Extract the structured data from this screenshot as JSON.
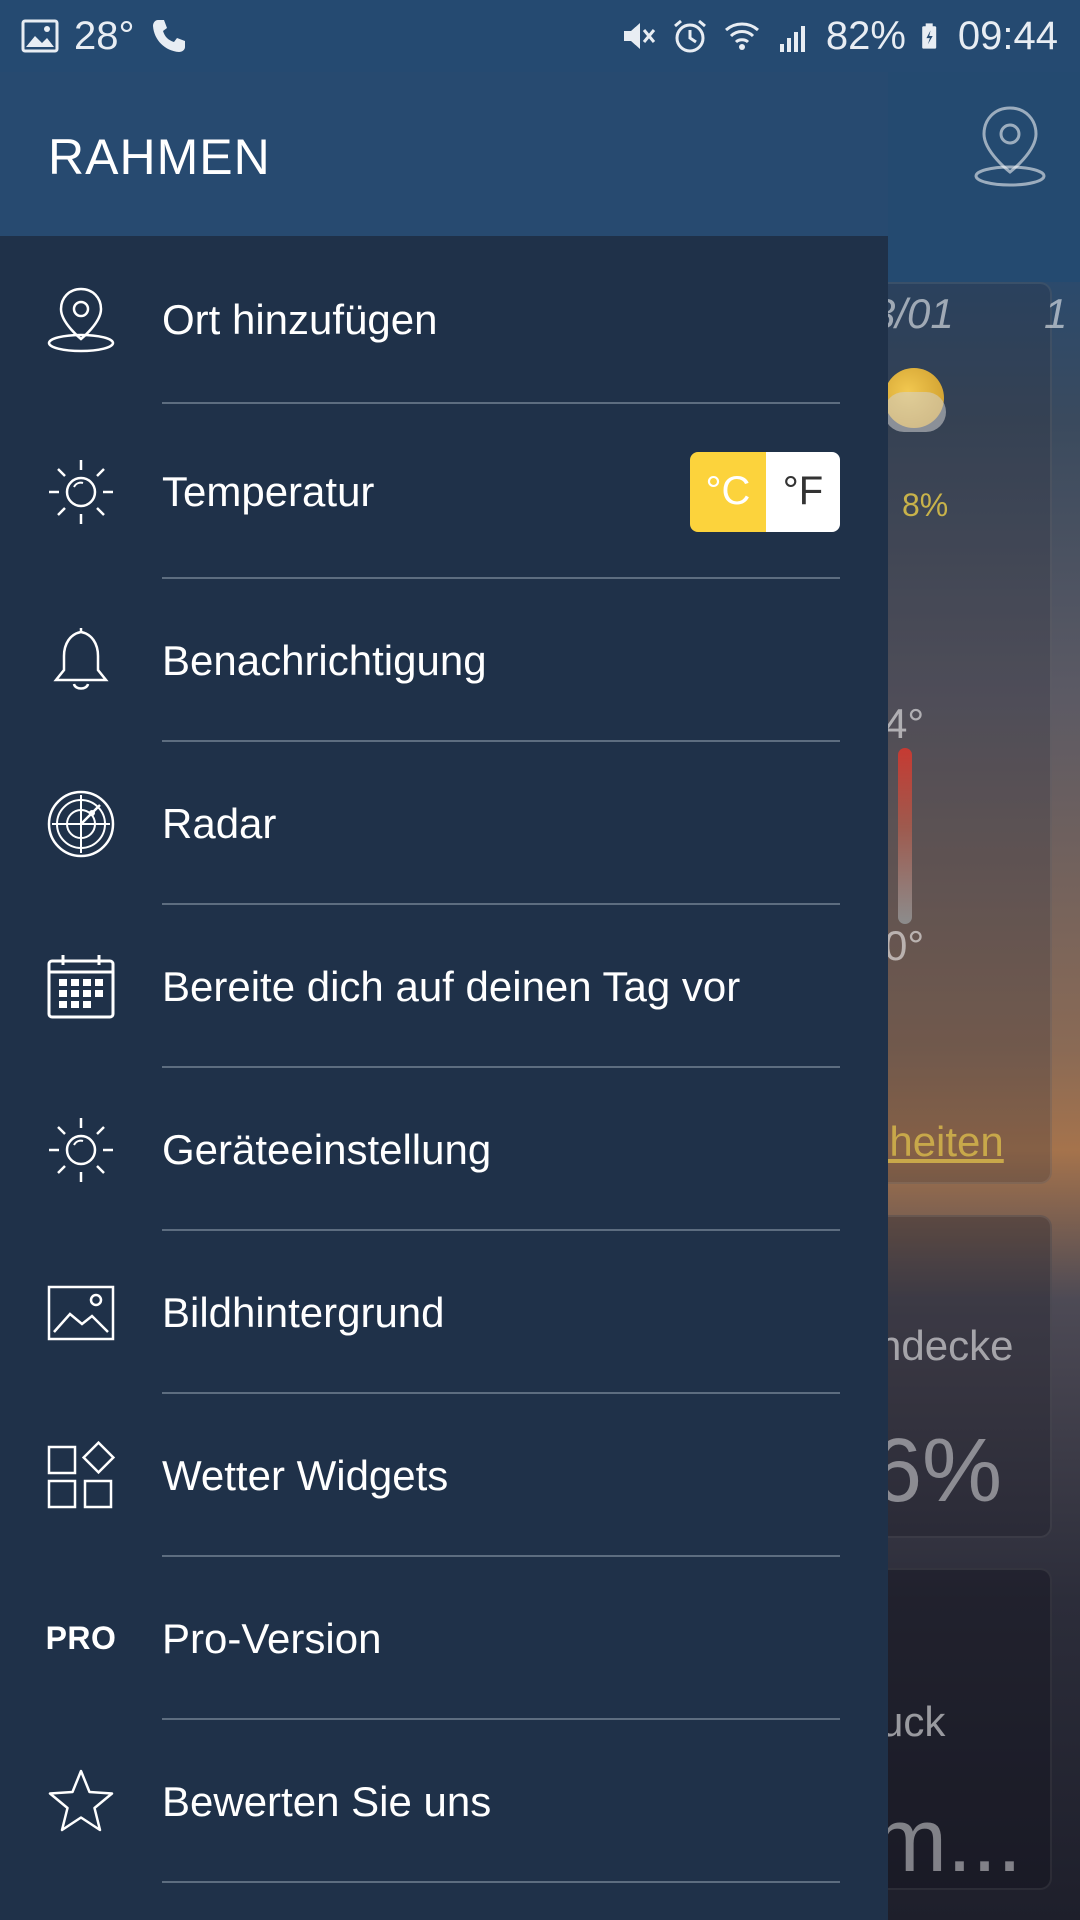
{
  "status_bar": {
    "temperature": "28°",
    "battery": "82%",
    "time": "09:44"
  },
  "drawer": {
    "title": "RAHMEN",
    "items": [
      {
        "label": "Ort hinzufügen",
        "icon": "location-pin-icon"
      },
      {
        "label": "Temperatur",
        "icon": "sun-icon"
      },
      {
        "label": "Benachrichtigung",
        "icon": "bell-icon"
      },
      {
        "label": "Radar",
        "icon": "radar-icon"
      },
      {
        "label": "Bereite dich auf deinen Tag vor",
        "icon": "calendar-icon"
      },
      {
        "label": "Geräteeinstellung",
        "icon": "sun-icon"
      },
      {
        "label": "Bildhintergrund",
        "icon": "image-icon"
      },
      {
        "label": "Wetter Widgets",
        "icon": "widgets-icon"
      },
      {
        "label": "Pro-Version",
        "icon": "pro-badge",
        "badge": "PRO"
      },
      {
        "label": "Bewerten Sie uns",
        "icon": "star-icon"
      }
    ],
    "unit_toggle": {
      "celsius": "°C",
      "fahrenheit": "°F",
      "selected": "°C",
      "selected_color": "#fcd33c"
    }
  },
  "background": {
    "date": "3/01",
    "date_next": "1",
    "precip": "8%",
    "high": "4°",
    "low": "0°",
    "details_link": "lheiten",
    "cloud_label": "ndecke",
    "cloud_value": "6%",
    "pressure_label": "uck",
    "pressure_value": "m..."
  },
  "colors": {
    "drawer_bg": "#1f3149",
    "header_bg": "#274a70",
    "accent": "#fcd33c"
  }
}
